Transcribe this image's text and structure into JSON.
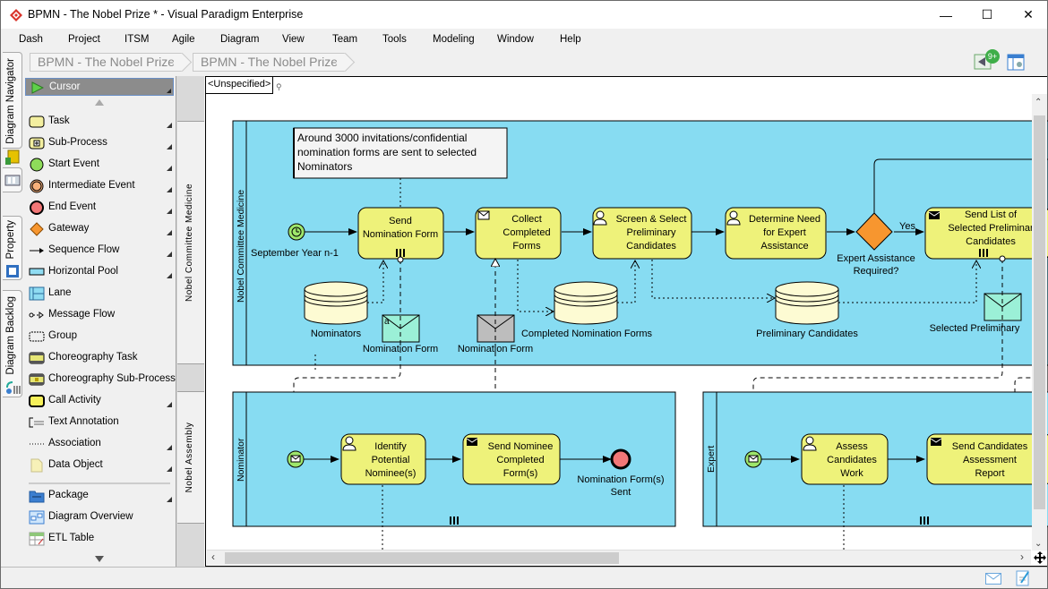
{
  "window": {
    "title": "BPMN - The Nobel Prize * - Visual Paradigm Enterprise",
    "minimize_glyph": "—",
    "maximize_glyph": "☐",
    "close_glyph": "✕"
  },
  "menu": [
    "Dash",
    "Project",
    "ITSM",
    "Agile",
    "Diagram",
    "View",
    "Team",
    "Tools",
    "Modeling",
    "Window",
    "Help"
  ],
  "breadcrumb": [
    "BPMN - The Nobel Prize",
    "BPMN - The Nobel Prize"
  ],
  "toolbar_icons": {
    "notifications_badge": "9+",
    "notifications_icon": "megaphone-icon",
    "layout_icon": "panel-layout-icon"
  },
  "side_tabs": [
    "Diagram Navigator",
    "Property",
    "Diagram Backlog"
  ],
  "palette": {
    "cursor": "Cursor",
    "items": [
      {
        "label": "Task",
        "icon": "task-icon",
        "more": true
      },
      {
        "label": "Sub-Process",
        "icon": "sub-process-icon",
        "more": true
      },
      {
        "label": "Start Event",
        "icon": "start-event-icon",
        "more": true
      },
      {
        "label": "Intermediate Event",
        "icon": "intermediate-event-icon",
        "more": true
      },
      {
        "label": "End Event",
        "icon": "end-event-icon",
        "more": true
      },
      {
        "label": "Gateway",
        "icon": "gateway-icon",
        "more": true
      },
      {
        "label": "Sequence Flow",
        "icon": "sequence-flow-icon",
        "more": true
      },
      {
        "label": "Horizontal Pool",
        "icon": "horizontal-pool-icon",
        "more": true
      },
      {
        "label": "Lane",
        "icon": "lane-icon",
        "more": false
      },
      {
        "label": "Message Flow",
        "icon": "message-flow-icon",
        "more": false
      },
      {
        "label": "Group",
        "icon": "group-icon",
        "more": false
      },
      {
        "label": "Choreography Task",
        "icon": "choreography-task-icon",
        "more": false
      },
      {
        "label": "Choreography Sub-Process",
        "icon": "choreography-sub-process-icon",
        "more": false
      },
      {
        "label": "Call Activity",
        "icon": "call-activity-icon",
        "more": true
      },
      {
        "label": "Text Annotation",
        "icon": "text-annotation-icon",
        "more": false
      },
      {
        "label": "Association",
        "icon": "association-icon",
        "more": true
      },
      {
        "label": "Data Object",
        "icon": "data-object-icon",
        "more": true
      }
    ],
    "items2": [
      {
        "label": "Package",
        "icon": "package-icon",
        "more": true
      },
      {
        "label": "Diagram Overview",
        "icon": "diagram-overview-icon",
        "more": false
      },
      {
        "label": "ETL Table",
        "icon": "etl-table-icon",
        "more": false
      }
    ]
  },
  "lane_bar": [
    "Nobel Committee Medicine",
    "Nobel Assembly"
  ],
  "canvas": {
    "scope": "<Unspecified>",
    "pools": {
      "committee": "Nobel Committee Medicine",
      "nominator": "Nominator",
      "expert": "Expert"
    },
    "annotation": [
      "Around 3000 invitations/confidential",
      "nomination forms are sent to selected",
      "Nominators"
    ],
    "start_event_label": "September Year n-1",
    "tasks": {
      "send_form": [
        "Send",
        "Nomination Form"
      ],
      "collect": [
        "Collect",
        "Completed",
        "Forms"
      ],
      "screen": [
        "Screen & Select",
        "Preliminary",
        "Candidates"
      ],
      "determine": [
        "Determine Need",
        "for Expert",
        "Assistance"
      ],
      "send_list": [
        "Send List of",
        "Selected Preliminar",
        "Candidates"
      ],
      "identify": [
        "Identify",
        "Potential",
        "Nominee(s)"
      ],
      "send_nominee": [
        "Send Nominee",
        "Completed",
        "Form(s)"
      ],
      "assess": [
        "Assess",
        "Candidates",
        "Work"
      ],
      "send_report": [
        "Send Candidates",
        "Assessment",
        "Report"
      ]
    },
    "gateway_label": [
      "Expert Assistance",
      "Required?"
    ],
    "yes_label": "Yes",
    "datastores": {
      "nominators": "Nominators",
      "completed": "Completed Nomination Forms",
      "preliminary": "Preliminary Candidates"
    },
    "messages": {
      "form1": "Nomination Form",
      "form2": "Nomination Form",
      "selected": "Selected Preliminary"
    },
    "end_event_label": [
      "Nomination Form(s)",
      "Sent"
    ]
  },
  "status_icons": [
    "mail-icon",
    "edit-document-icon"
  ]
}
